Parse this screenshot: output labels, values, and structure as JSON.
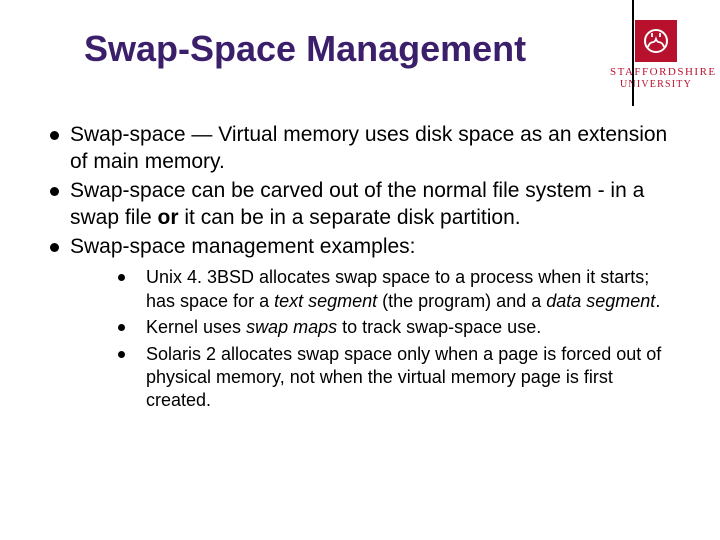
{
  "logo": {
    "line1": "STAFFORDSHIRE",
    "line2": "UNIVERSITY"
  },
  "title": "Swap-Space Management",
  "bullets": [
    {
      "pre": "Swap-space — Virtual memory uses disk space as an extension of main memory."
    },
    {
      "seg1": "Swap-space can be carved out of the normal file system - in a swap file ",
      "bold": "or",
      "seg2": " it can be in a separate disk partition."
    },
    {
      "pre": "Swap-space management examples:"
    }
  ],
  "sub": [
    {
      "s1": "Unix 4. 3BSD allocates swap space to a process when it starts; has space for a ",
      "i1": "text segment",
      "s2": " (the program) and a ",
      "i2": "data segment",
      "s3": "."
    },
    {
      "s1": "Kernel uses ",
      "i1": "swap maps",
      "s2": " to track swap-space use."
    },
    {
      "s1": "Solaris 2 allocates swap space only when a page is forced out of physical memory, not when the virtual memory page is first created."
    }
  ]
}
